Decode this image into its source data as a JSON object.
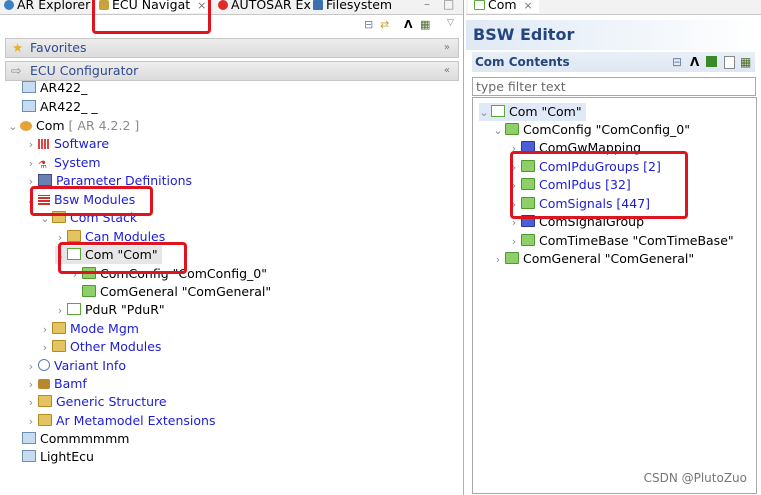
{
  "left_tabs": [
    {
      "label": "AR Explorer"
    },
    {
      "label": "ECU Navigat",
      "close": "⨯"
    },
    {
      "label": "AUTOSAR Ex"
    },
    {
      "label": "Filesystem"
    }
  ],
  "favorites": {
    "label": "Favorites"
  },
  "configurator": {
    "label": "ECU Configurator"
  },
  "tree": [
    {
      "label": "AR422_"
    },
    {
      "label": "AR422_ _"
    },
    {
      "label": "Com",
      "suffix": "[ AR 4.2.2 ]"
    },
    {
      "label": "Software"
    },
    {
      "label": "System"
    },
    {
      "label": "Parameter Definitions"
    },
    {
      "label": "Bsw Modules"
    },
    {
      "label": "Com Stack"
    },
    {
      "label": "Can Modules"
    },
    {
      "label": "Com \"Com\""
    },
    {
      "label": "ComConfig \"ComConfig_0\""
    },
    {
      "label": "ComGeneral \"ComGeneral\""
    },
    {
      "label": "PduR \"PduR\""
    },
    {
      "label": "Mode Mgm"
    },
    {
      "label": "Other Modules"
    },
    {
      "label": "Variant Info"
    },
    {
      "label": "Bamf"
    },
    {
      "label": "Generic Structure"
    },
    {
      "label": "Ar Metamodel Extensions"
    },
    {
      "label": "Commmmmm"
    },
    {
      "label": "LightEcu"
    }
  ],
  "right": {
    "tab": "Com",
    "tab_close": "⨯",
    "editor_title": "BSW Editor",
    "contents_header": "Com Contents",
    "filter_placeholder": "type filter text",
    "tree": [
      {
        "label": "Com \"Com\""
      },
      {
        "label": "ComConfig \"ComConfig_0\""
      },
      {
        "label": "ComGwMapping"
      },
      {
        "label": "ComIPduGroups [2]"
      },
      {
        "label": "ComIPdus [32]"
      },
      {
        "label": "ComSignals [447]"
      },
      {
        "label": "ComSignalGroup"
      },
      {
        "label": "ComTimeBase \"ComTimeBase\""
      },
      {
        "label": "ComGeneral \"ComGeneral\""
      }
    ]
  },
  "watermark": "CSDN @PlutoZuo"
}
